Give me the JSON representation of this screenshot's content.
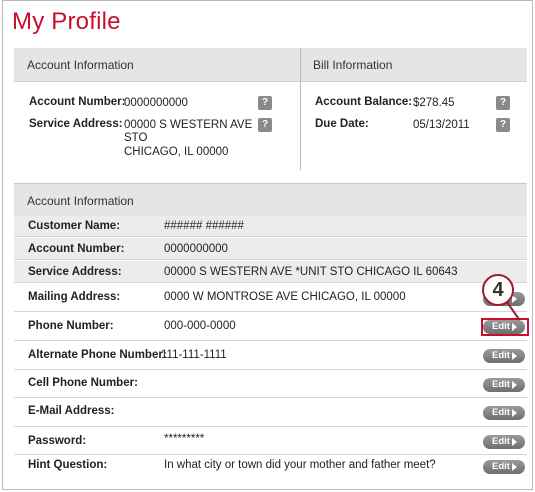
{
  "page": {
    "title": "My Profile"
  },
  "summary": {
    "left_header": "Account Information",
    "right_header": "Bill Information",
    "account_number_label": "Account Number:",
    "account_number": "0000000000",
    "service_address_label": "Service Address:",
    "service_address_line1": "00000 S WESTERN AVE",
    "service_address_line2": "STO",
    "service_address_line3": "CHICAGO, IL 00000",
    "balance_label": "Account Balance:",
    "balance": "$278.45",
    "due_label": "Due Date:",
    "due": "05/13/2011",
    "help_glyph": "?"
  },
  "detail": {
    "header": "Account Information",
    "edit_label": "Edit",
    "rows": [
      {
        "label": "Customer Name:",
        "value": "###### ######",
        "editable": false
      },
      {
        "label": "Account Number:",
        "value": "0000000000",
        "editable": false
      },
      {
        "label": "Service Address:",
        "value": "00000 S WESTERN AVE *UNIT STO CHICAGO IL 60643",
        "editable": false
      },
      {
        "label": "Mailing Address:",
        "value": "0000 W MONTROSE AVE CHICAGO, IL 00000",
        "editable": true
      },
      {
        "label": "Phone Number:",
        "value": "000-000-0000",
        "editable": true
      },
      {
        "label": "Alternate Phone Number:",
        "value": "111-111-1111",
        "editable": true
      },
      {
        "label": "Cell Phone Number:",
        "value": "",
        "editable": true
      },
      {
        "label": "E-Mail Address:",
        "value": "",
        "editable": true
      },
      {
        "label": "Password:",
        "value": "*********",
        "editable": true
      },
      {
        "label": "Hint Question:",
        "value": "In what city or town did your mother and father meet?",
        "editable": true
      }
    ]
  },
  "callout": {
    "number": "4"
  },
  "colors": {
    "accent": "#c8102e",
    "header_bg": "#e5e5e5",
    "button_gray": "#7d7d7d"
  }
}
